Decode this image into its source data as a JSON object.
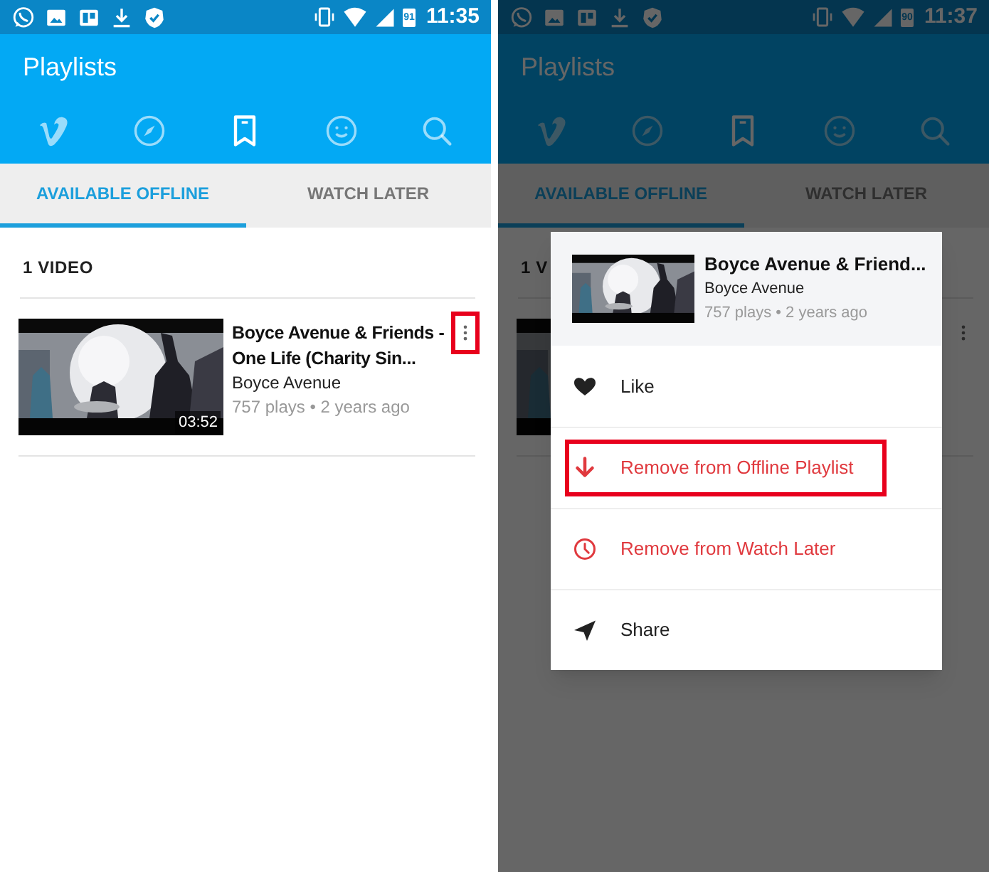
{
  "screens": [
    {
      "status_bar": {
        "time": "11:35",
        "battery": "91"
      },
      "title": "Playlists",
      "nav": [
        {
          "kind": "vimeo",
          "selected": false
        },
        {
          "kind": "explore",
          "selected": false
        },
        {
          "kind": "bookmark",
          "selected": true
        },
        {
          "kind": "face",
          "selected": false
        },
        {
          "kind": "search",
          "selected": false
        }
      ],
      "tabs": [
        {
          "label": "AVAILABLE OFFLINE",
          "selected": true
        },
        {
          "label": "WATCH LATER",
          "selected": false
        }
      ],
      "count": "1 VIDEO",
      "videos": [
        {
          "kind": "full",
          "title": "Boyce Avenue & Friends - One Life (Charity Sin...",
          "channel": "Boyce Avenue",
          "meta": "757 plays • 2 years ago",
          "duration": "03:52",
          "menu_highlighted": true
        }
      ]
    },
    {
      "status_bar": {
        "time": "11:37",
        "battery": "90"
      },
      "title": "Playlists",
      "dimmed": true,
      "nav": [
        {
          "kind": "vimeo",
          "selected": false
        },
        {
          "kind": "explore",
          "selected": false
        },
        {
          "kind": "bookmark",
          "selected": true
        },
        {
          "kind": "face",
          "selected": false
        },
        {
          "kind": "search",
          "selected": false
        }
      ],
      "tabs": [
        {
          "label": "AVAILABLE OFFLINE",
          "selected": true
        },
        {
          "label": "WATCH LATER",
          "selected": false
        }
      ],
      "count": "1 V",
      "videos": [
        {
          "kind": "covered",
          "menu_highlighted": false
        }
      ],
      "menu": {
        "header": {
          "title": "Boyce Avenue & Friend...",
          "channel": "Boyce Avenue",
          "meta": "757 plays • 2 years ago"
        },
        "items": [
          {
            "kind": "like",
            "label": "Like",
            "danger": false,
            "highlighted": false
          },
          {
            "kind": "download",
            "label": "Remove from Offline Playlist",
            "danger": true,
            "highlighted": true
          },
          {
            "kind": "clock",
            "label": "Remove from Watch Later",
            "danger": true,
            "highlighted": false
          },
          {
            "kind": "share",
            "label": "Share",
            "danger": false,
            "highlighted": false
          }
        ]
      }
    }
  ]
}
